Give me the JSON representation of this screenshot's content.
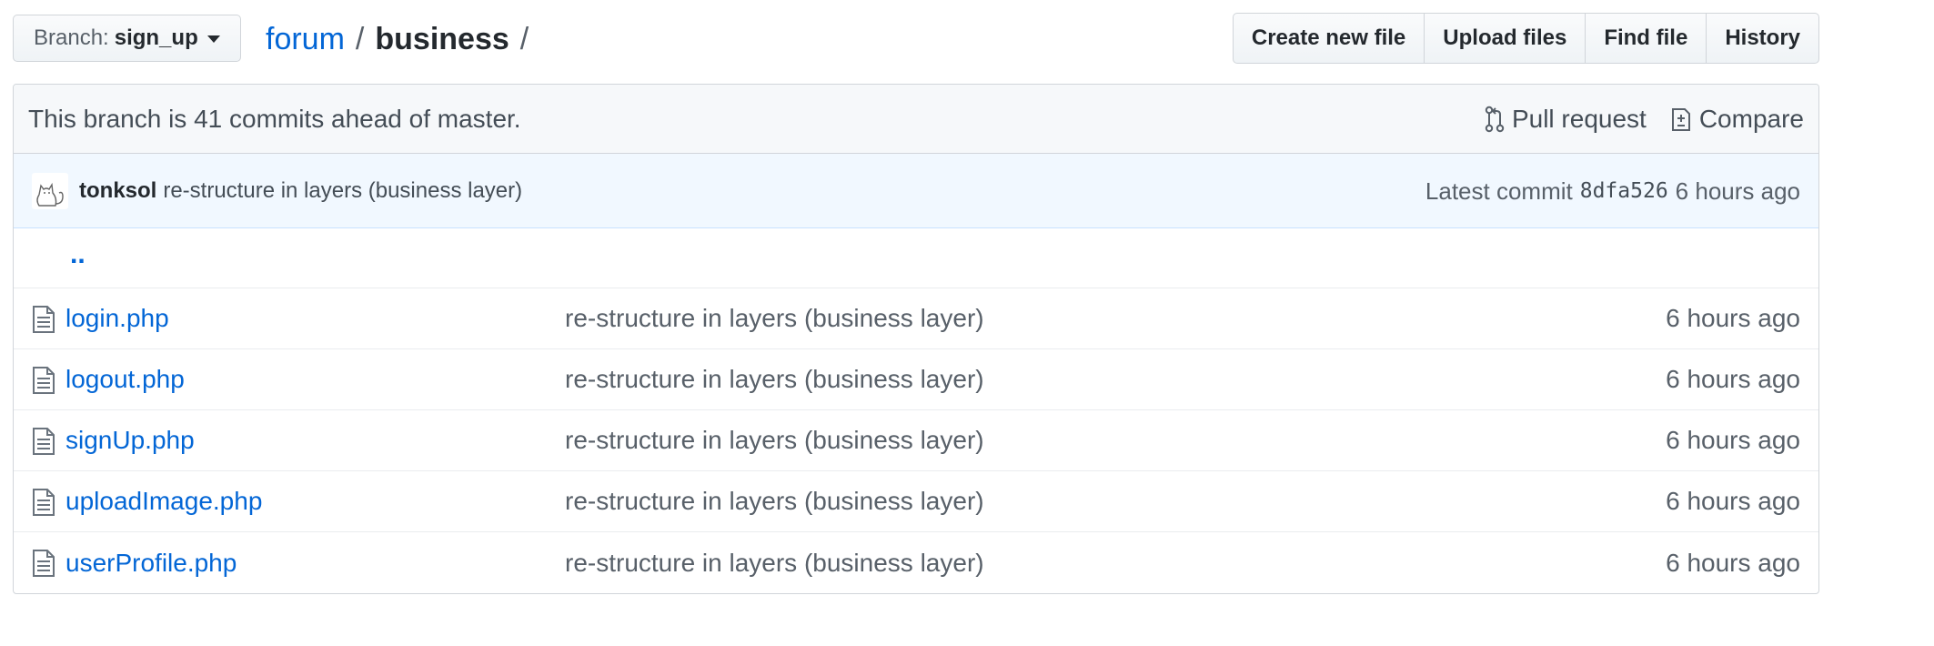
{
  "branch_selector": {
    "prefix": "Branch:",
    "name": "sign_up"
  },
  "breadcrumb": {
    "repo": "forum",
    "separator": "/",
    "directory": "business",
    "trailing": "/"
  },
  "file_actions": {
    "create_new_file": "Create new file",
    "upload_files": "Upload files",
    "find_file": "Find file",
    "history": "History"
  },
  "branch_info": {
    "status": "This branch is 41 commits ahead of master.",
    "pull_request": "Pull request",
    "compare": "Compare"
  },
  "latest_commit": {
    "author": "tonksol",
    "message": "re-structure in layers (business layer)",
    "label": "Latest commit",
    "sha": "8dfa526",
    "age": "6 hours ago"
  },
  "parent_dir": "..",
  "files": [
    {
      "name": "login.php",
      "message": "re-structure in layers (business layer)",
      "age": "6 hours ago"
    },
    {
      "name": "logout.php",
      "message": "re-structure in layers (business layer)",
      "age": "6 hours ago"
    },
    {
      "name": "signUp.php",
      "message": "re-structure in layers (business layer)",
      "age": "6 hours ago"
    },
    {
      "name": "uploadImage.php",
      "message": "re-structure in layers (business layer)",
      "age": "6 hours ago"
    },
    {
      "name": "userProfile.php",
      "message": "re-structure in layers (business layer)",
      "age": "6 hours ago"
    }
  ],
  "icons": {
    "file": "file-icon",
    "pull_request": "git-pull-request-icon",
    "compare": "diff-icon",
    "caret": "caret-down-icon",
    "avatar": "avatar"
  },
  "colors": {
    "link": "#0366d6",
    "muted": "#586069",
    "commit_bar_bg": "#f1f8ff",
    "branch_info_bg": "#f6f8fa"
  }
}
